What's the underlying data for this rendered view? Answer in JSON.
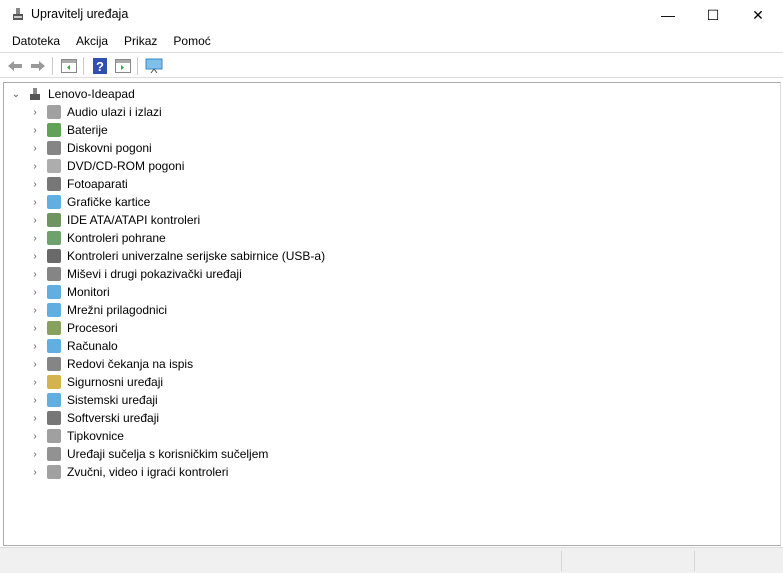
{
  "window": {
    "title": "Upravitelj uređaja",
    "minimize": "—",
    "maximize": "☐",
    "close": "✕"
  },
  "menu": [
    "Datoteka",
    "Akcija",
    "Prikaz",
    "Pomoć"
  ],
  "toolbar": [
    "back",
    "forward",
    "show-hide-console-tree",
    "help",
    "properties",
    "scan-hardware"
  ],
  "tree": {
    "root": "Lenovo-Ideapad",
    "items": [
      {
        "label": "Audio ulazi i izlazi",
        "icon": "speaker-icon",
        "color": "#8a8a8a"
      },
      {
        "label": "Baterije",
        "icon": "battery-icon",
        "color": "#3a8a2e"
      },
      {
        "label": "Diskovni pogoni",
        "icon": "disk-icon",
        "color": "#666666"
      },
      {
        "label": "DVD/CD-ROM pogoni",
        "icon": "dvd-icon",
        "color": "#999999"
      },
      {
        "label": "Fotoaparati",
        "icon": "camera-icon",
        "color": "#555555"
      },
      {
        "label": "Grafičke kartice",
        "icon": "display-adapter-icon",
        "color": "#3a9ad9"
      },
      {
        "label": "IDE ATA/ATAPI kontroleri",
        "icon": "ide-controller-icon",
        "color": "#4a7a3a"
      },
      {
        "label": "Kontroleri pohrane",
        "icon": "storage-controller-icon",
        "color": "#4a8a4a"
      },
      {
        "label": "Kontroleri univerzalne serijske sabirnice (USB-a)",
        "icon": "usb-icon",
        "color": "#444444"
      },
      {
        "label": "Miševi i drugi pokazivački uređaji",
        "icon": "mouse-icon",
        "color": "#666666"
      },
      {
        "label": "Monitori",
        "icon": "monitor-icon",
        "color": "#3a9ad9"
      },
      {
        "label": "Mrežni prilagodnici",
        "icon": "network-icon",
        "color": "#3a9ad9"
      },
      {
        "label": "Procesori",
        "icon": "processor-icon",
        "color": "#6a8a3a"
      },
      {
        "label": "Računalo",
        "icon": "computer-icon",
        "color": "#3a9ad9"
      },
      {
        "label": "Redovi čekanja na ispis",
        "icon": "printer-icon",
        "color": "#666666"
      },
      {
        "label": "Sigurnosni uređaji",
        "icon": "security-key-icon",
        "color": "#c8a020"
      },
      {
        "label": "Sistemski uređaji",
        "icon": "system-icon",
        "color": "#3a9ad9"
      },
      {
        "label": "Softverski uređaji",
        "icon": "software-device-icon",
        "color": "#555555"
      },
      {
        "label": "Tipkovnice",
        "icon": "keyboard-icon",
        "color": "#888888"
      },
      {
        "label": "Uređaji sučelja s korisničkim sučeljem",
        "icon": "hid-icon",
        "color": "#777777"
      },
      {
        "label": "Zvučni, video i igraći kontroleri",
        "icon": "sound-icon",
        "color": "#8a8a8a"
      }
    ]
  }
}
